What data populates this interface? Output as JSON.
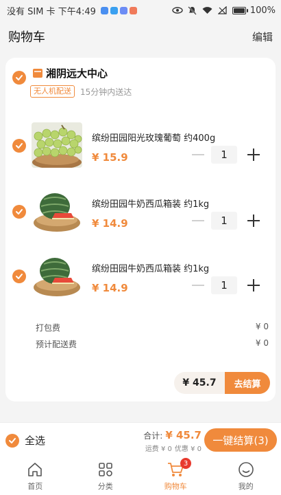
{
  "status_bar": {
    "carrier": "没有 SIM 卡 下午4:49",
    "battery": "100%",
    "battery_level": 1.0
  },
  "header": {
    "title": "购物车",
    "edit_label": "编辑"
  },
  "store": {
    "name": "湘阴远大中心",
    "tag": "无人机配送",
    "delivery_time": "15分钟内送达",
    "checked": true
  },
  "items": [
    {
      "name": "缤纷田园阳光玫瑰葡萄 约400g",
      "price": "¥ 15.9",
      "quantity": "1",
      "image": "grapes",
      "checked": true
    },
    {
      "name": "缤纷田园牛奶西瓜箱装 约1kg",
      "price": "¥ 14.9",
      "quantity": "1",
      "image": "watermelon",
      "checked": true
    },
    {
      "name": "缤纷田园牛奶西瓜箱装 约1kg",
      "price": "¥ 14.9",
      "quantity": "1",
      "image": "watermelon",
      "checked": true
    }
  ],
  "fees": {
    "packing_label": "打包费",
    "packing_value": "¥ 0",
    "delivery_label": "预计配送费",
    "delivery_value": "¥ 0"
  },
  "store_checkout": {
    "total": "¥ 45.7",
    "button_label": "去结算"
  },
  "bottom": {
    "select_all_label": "全选",
    "total_label": "合计:",
    "total_value": "¥ 45.7",
    "shipping": "运费 ¥ 0",
    "discount": "优惠 ¥ 0",
    "checkout_label": "一键结算(3)"
  },
  "tabs": [
    {
      "label": "首页",
      "icon": "home-icon"
    },
    {
      "label": "分类",
      "icon": "category-icon"
    },
    {
      "label": "购物车",
      "icon": "cart-icon",
      "badge": "3",
      "active": true
    },
    {
      "label": "我的",
      "icon": "profile-icon"
    }
  ],
  "colors": {
    "accent": "#f08a3c",
    "badge": "#e83a2e",
    "background": "#f4f4f4"
  }
}
